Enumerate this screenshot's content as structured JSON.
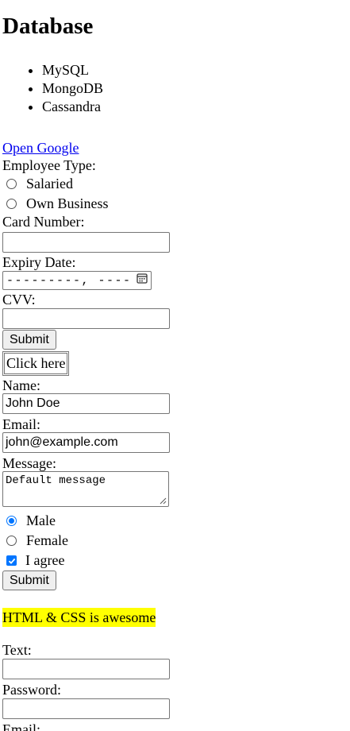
{
  "heading": "Database",
  "databases": [
    "MySQL",
    "MongoDB",
    "Cassandra"
  ],
  "link_text": "Open Google",
  "employee": {
    "label": "Employee Type:",
    "options": [
      "Salaried",
      "Own Business"
    ]
  },
  "card": {
    "number_label": "Card Number:",
    "number_value": "",
    "expiry_label": "Expiry Date:",
    "expiry_placeholder": "---------, ----",
    "cvv_label": "CVV:",
    "cvv_value": "",
    "submit_label": "Submit"
  },
  "table_button_label": "Click here",
  "contact": {
    "name_label": "Name:",
    "name_value": "John Doe",
    "email_label": "Email:",
    "email_value": "john@example.com",
    "message_label": "Message:",
    "message_value": "Default message",
    "gender_options": [
      {
        "label": "Male",
        "checked": true
      },
      {
        "label": "Female",
        "checked": false
      }
    ],
    "agree_label": "I agree",
    "agree_checked": true,
    "submit_label": "Submit"
  },
  "highlight_text": "HTML & CSS is awesome",
  "misc": {
    "text_label": "Text:",
    "password_label": "Password:",
    "email_label": "Email:"
  },
  "colors": {
    "link": "#0000ee",
    "accent": "#0075ff",
    "highlight": "#ffff00"
  }
}
